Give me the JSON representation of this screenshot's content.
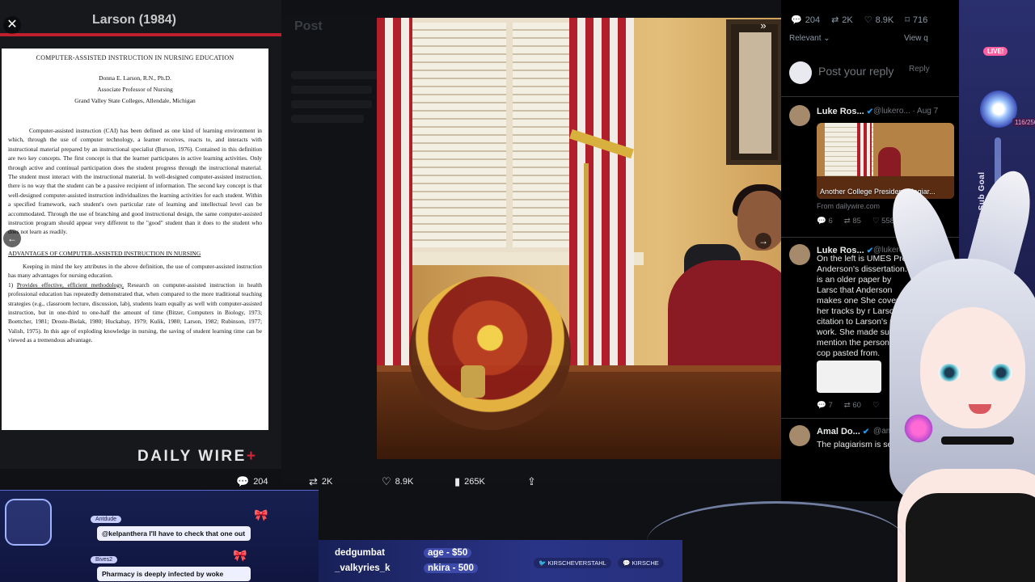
{
  "doc_panel": {
    "title": "Larson (1984)",
    "close_glyph": "✕",
    "paper": {
      "title": "COMPUTER-ASSISTED INSTRUCTION IN NURSING EDUCATION",
      "author_name": "Donna E. Larson, R.N., Ph.D.",
      "author_role": "Associate Professor of Nursing",
      "author_org": "Grand Valley State Colleges, Allendale, Michigan",
      "para1": "Computer-assisted instruction (CAI) has been defined as one kind of learning environment in which, through the use of computer technology, a learner receives, reacts to, and interacts with instructional material prepared by an instructional specialist (Burson, 1976). Contained in this definition are two key concepts. The first concept is that the learner participates in active learning activities. Only through active and continual participation does the student progress through the instructional material. The student must interact with the instructional material. In well-designed computer-assisted instruction, there is no way that the student can be a passive recipient of information. The second key concept is that well-designed computer-assisted instruction individualizes the learning activities for each student. Within a specified framework, each student's own particular rate of learning and intellectual level can be accommodated. Through the use of branching and good instructional design, the same computer-assisted instruction program should appear very different to the \"good\" student than it does to the student who does not learn as readily.",
      "heading": "ADVANTAGES OF COMPUTER-ASSISTED INSTRUCTION IN NURSING",
      "para2": "Keeping in mind the key attributes in the above definition, the use of computer-assisted instruction has many advantages for nursing education.",
      "item_num": "1)",
      "item_title": "Provides effective, efficient methodology.",
      "item_body": "Research on computer-assisted instruction in health professional education has repeatedly demonstrated that, when compared to the more traditional teaching strategies (e.g., classroom lecture, discussion, lab), students learn equally as well with computer-assisted instruction, but in one-third to one-half the amount of time (Bitzer, Computers in Biology, 1973; Boettcher, 1981; Droste-Bielak, 1980; Huckabay, 1979; Kulik, 1980; Larson, 1982; Rubinson, 1977; Valish, 1975). In this age of exploding knowledge in nursing, the saving of student learning time can be viewed as a tremendous advantage."
    },
    "logo_text": "DAILY WIRE",
    "logo_plus": "+",
    "nav_prev_glyph": "←"
  },
  "bg_post": {
    "header": "Post"
  },
  "photo": {
    "expand_glyph": "»",
    "nav_next_glyph": "→"
  },
  "post_actions": {
    "replies": "204",
    "reposts": "2K",
    "likes": "8.9K",
    "views": "265K"
  },
  "replies_panel": {
    "stats": {
      "replies": "204",
      "reposts": "2K",
      "likes": "8.9K",
      "bookmarks": "716"
    },
    "sort_label": "Relevant",
    "view_quotes": "View q",
    "reply_placeholder": "Post your reply",
    "reply_button": "Reply",
    "tweets": [
      {
        "name": "Luke Ros...",
        "handle": "@lukero... · Aug 7",
        "card_caption": "Another College President Plagiar...",
        "from": "From dailywire.com",
        "metrics": {
          "replies": "6",
          "reposts": "85",
          "likes": "558"
        }
      },
      {
        "name": "Luke Ros...",
        "handle": "@lukero...",
        "text": "On the left is UMES Presi Anderson's dissertation. is an older paper by Larsc that Anderson makes one She covers her tracks by r Larson's citation to Larson's prior work. She made sure n mention the person she cop pasted from.",
        "metrics": {
          "replies": "7",
          "reposts": "60",
          "likes": ""
        }
      },
      {
        "name": "Amal Do...",
        "handle": "@ama",
        "text": "The plagiarism is sec"
      }
    ]
  },
  "stream": {
    "live_badge": "LIVE!",
    "goal_label": "Daily Sub Goal",
    "goal_count": "116/250",
    "chat": [
      {
        "user": "Antdude",
        "message": "@kelpanthera I'll have to check that one out"
      },
      {
        "user": "Bives2",
        "message": "Pharmacy is deeply infected by woke"
      }
    ],
    "ticker": {
      "line1_a": "dedgumbat",
      "line1_b": "age - $50",
      "line2_a": "_valkyries_k",
      "line2_b": "nkira - 500"
    },
    "social": {
      "twitter": "KIRSCHEVERSTAHL",
      "discord": "KIRSCHE"
    }
  }
}
